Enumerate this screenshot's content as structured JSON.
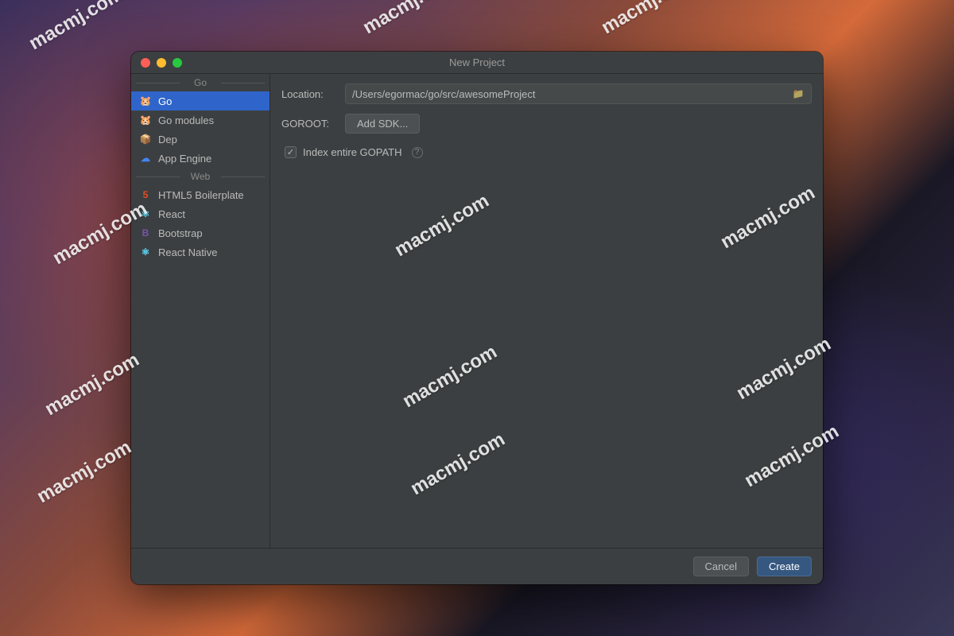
{
  "window": {
    "title": "New Project"
  },
  "sidebar": {
    "sections": [
      {
        "header": "Go",
        "items": [
          {
            "label": "Go",
            "icon": "go-icon",
            "icon_color": "#6ad7e5",
            "selected": true
          },
          {
            "label": "Go modules",
            "icon": "go-icon",
            "icon_color": "#6ad7e5",
            "selected": false
          },
          {
            "label": "Dep",
            "icon": "dep-icon",
            "icon_color": "#d4a05a",
            "selected": false
          },
          {
            "label": "App Engine",
            "icon": "appengine-icon",
            "icon_color": "#4285f4",
            "selected": false
          }
        ]
      },
      {
        "header": "Web",
        "items": [
          {
            "label": "HTML5 Boilerplate",
            "icon": "html5-icon",
            "icon_color": "#e44d26",
            "selected": false
          },
          {
            "label": "React",
            "icon": "react-icon",
            "icon_color": "#61dafb",
            "selected": false
          },
          {
            "label": "Bootstrap",
            "icon": "bootstrap-icon",
            "icon_color": "#7952b3",
            "selected": false
          },
          {
            "label": "React Native",
            "icon": "react-icon",
            "icon_color": "#61dafb",
            "selected": false
          }
        ]
      }
    ]
  },
  "form": {
    "location_label": "Location:",
    "location_value": "/Users/egormac/go/src/awesomeProject",
    "goroot_label": "GOROOT:",
    "add_sdk_label": "Add SDK...",
    "index_gopath_label": "Index entire GOPATH",
    "index_gopath_checked": true
  },
  "footer": {
    "cancel_label": "Cancel",
    "create_label": "Create"
  },
  "watermark_text": "macmj.com",
  "icons": {
    "go-icon": "🐹",
    "dep-icon": "📦",
    "appengine-icon": "☁",
    "html5-icon": "5",
    "react-icon": "⚛",
    "bootstrap-icon": "B",
    "folder-icon": "📁",
    "check-icon": "✓",
    "help-icon": "?"
  }
}
